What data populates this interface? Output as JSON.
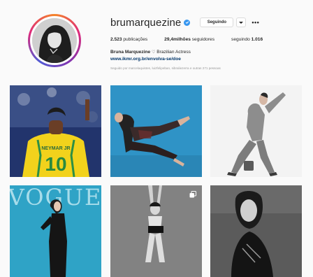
{
  "profile": {
    "username": "brumarquezine",
    "follow_button": "Seguindo",
    "more_label": "•••",
    "stats": [
      {
        "value": "2.523",
        "label": " publicações"
      },
      {
        "value": "29,4milhões",
        "label": " seguidores"
      },
      {
        "label": "seguindo ",
        "value": "1.016"
      }
    ],
    "full_name": "Bruna Marquezine",
    "bio": " Brazilian Actress",
    "link": "www.ikmr.org.br/envolva-se/doe",
    "followed_by": "Seguido por marcelaquistes, luizfelipeban, sibraliezerra e outras 271 pessoas"
  },
  "posts": [
    {
      "name": "post-soccer",
      "bg": "#1d2f6b"
    },
    {
      "name": "post-blue-lace",
      "bg": "#2c8fbe"
    },
    {
      "name": "post-gray-suit",
      "bg": "#f2f2f2"
    },
    {
      "name": "post-vogue",
      "bg": "#31a2c4",
      "overlay_text": "VOGUE"
    },
    {
      "name": "post-bw-dance",
      "bg": "#8a8a8a"
    },
    {
      "name": "post-bw-portrait",
      "bg": "#5a5a5a"
    }
  ],
  "colors": {
    "verified": "#3897f0",
    "link": "#003569",
    "muted": "#999999"
  }
}
